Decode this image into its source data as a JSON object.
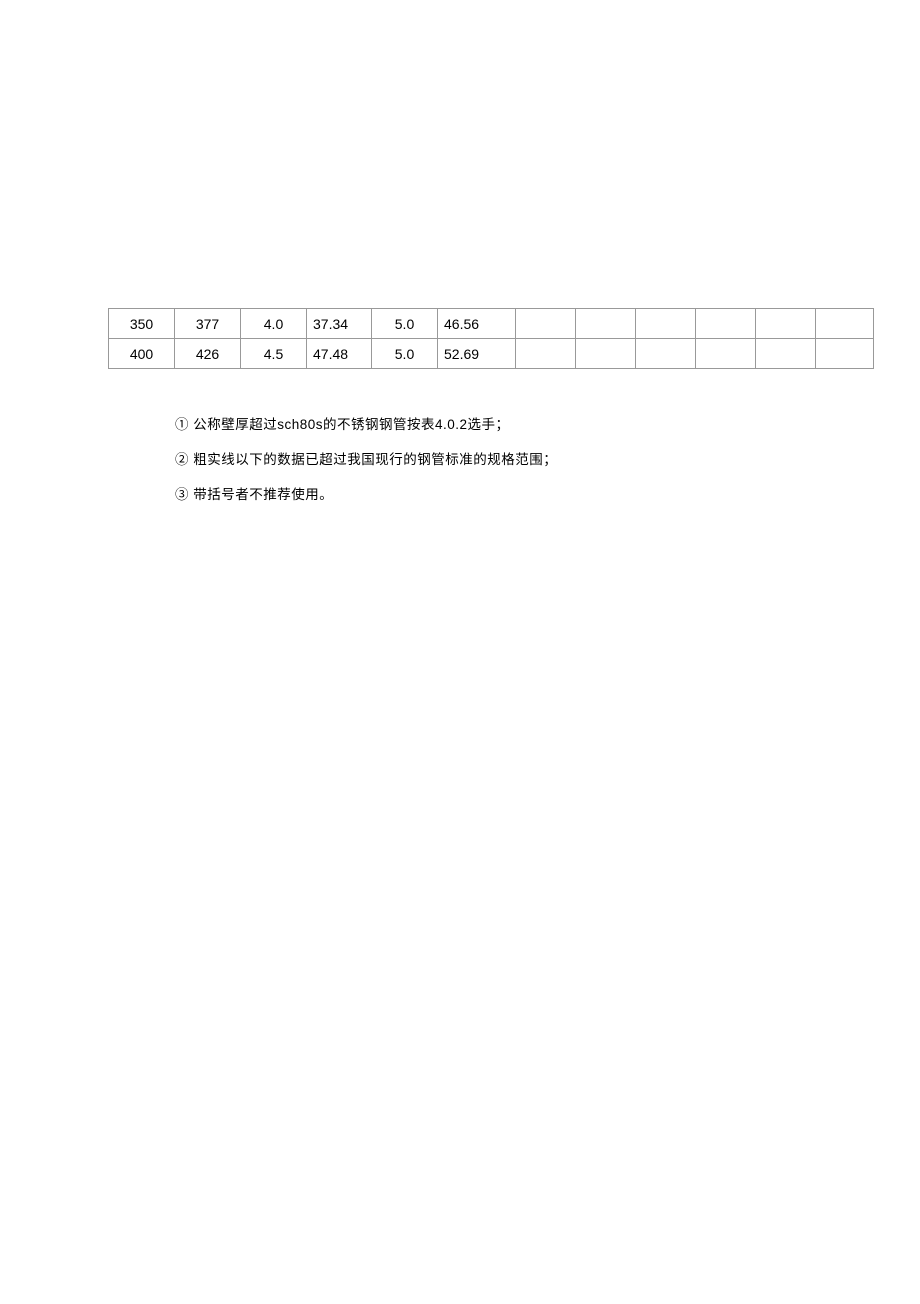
{
  "table": {
    "rows": [
      {
        "c0": "350",
        "c1": "377",
        "c2": "4.0",
        "c3": "37.34",
        "c4": "5.0",
        "c5": "46.56",
        "c6": "",
        "c7": "",
        "c8": "",
        "c9": "",
        "c10": "",
        "c11": ""
      },
      {
        "c0": "400",
        "c1": "426",
        "c2": "4.5",
        "c3": "47.48",
        "c4": "5.0",
        "c5": "52.69",
        "c6": "",
        "c7": "",
        "c8": "",
        "c9": "",
        "c10": "",
        "c11": ""
      }
    ]
  },
  "notes": {
    "n1": "①  公称壁厚超过sch80s的不锈钢钢管按表4.0.2选手；",
    "n2": "②  粗实线以下的数据已超过我国现行的钢管标准的规格范围；",
    "n3": "③  带括号者不推荐使用。"
  }
}
